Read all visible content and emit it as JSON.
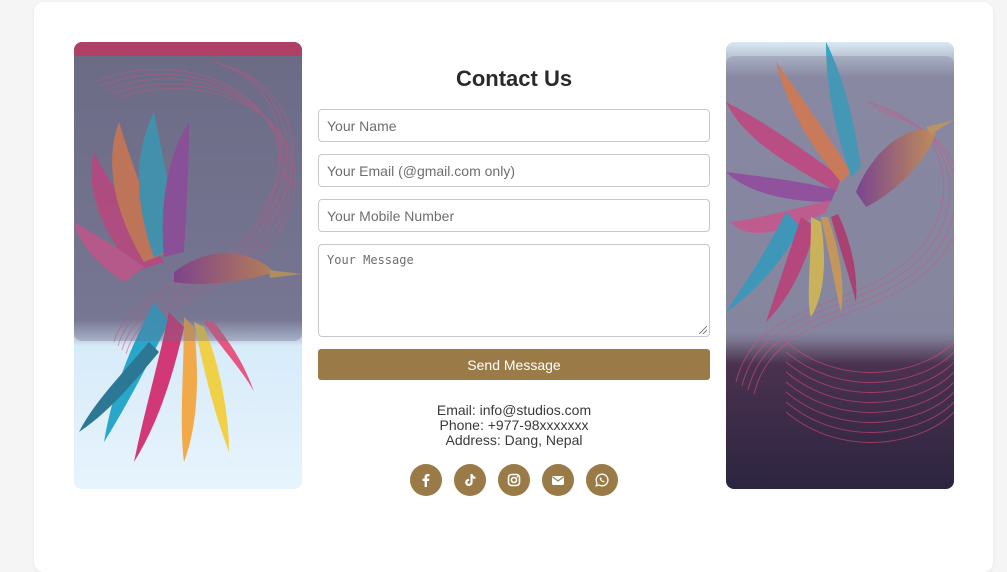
{
  "form": {
    "title": "Contact Us",
    "name_placeholder": "Your Name",
    "email_placeholder": "Your Email (@gmail.com only)",
    "mobile_placeholder": "Your Mobile Number",
    "message_placeholder": "Your Message",
    "submit_label": "Send Message"
  },
  "contact": {
    "email": "Email: info@studios.com",
    "phone": "Phone: +977-98xxxxxxx",
    "address": "Address: Dang, Nepal"
  },
  "socials": [
    {
      "icon": "facebook-icon"
    },
    {
      "icon": "tiktok-icon"
    },
    {
      "icon": "instagram-icon"
    },
    {
      "icon": "envelope-icon"
    },
    {
      "icon": "whatsapp-icon"
    }
  ],
  "colors": {
    "accent": "#9a7b47",
    "card_background": "#ffffff",
    "page_background": "#f5f5f6",
    "title_text": "#2a2a2a"
  }
}
